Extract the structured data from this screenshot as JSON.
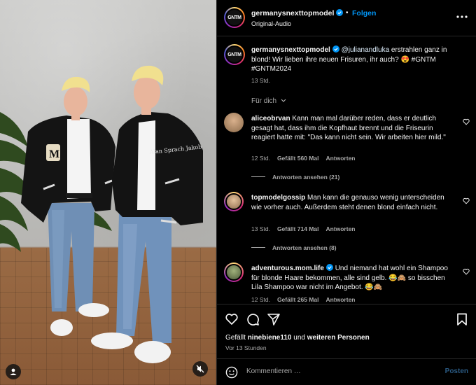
{
  "post": {
    "username": "germanysnexttopmodel",
    "follow_label": "Folgen",
    "separator": "•",
    "audio": "Original-Audio",
    "avatar_text": "GNTM",
    "caption_mention": "@julianandluka",
    "caption_text": " erstrahlen ganz in blond! Wir lieben ihre neuen Frisuren, ihr auch? 😍 #GNTM #GNTM2024",
    "caption_time": "13 Std."
  },
  "filter_label": "Für dich",
  "comments": [
    {
      "username": "aliceobrvan",
      "text": "Kann man mal darüber reden, dass er deutlich gesagt hat, dass ihm die Kopfhaut brennt und die Friseurin reagiert hatte mit: \"Das kann nicht sein. Wir arbeiten hier mild.\"",
      "time": "12 Std.",
      "likes": "Gefällt 560 Mal",
      "reply": "Antworten",
      "view_replies": "Antworten ansehen (21)"
    },
    {
      "username": "topmodelgossip",
      "text": "Man kann die genauso wenig unterscheiden wie vorher auch. Außerdem steht denen blond einfach nicht.",
      "time": "13 Std.",
      "likes": "Gefällt 714 Mal",
      "reply": "Antworten",
      "view_replies": "Antworten ansehen (8)"
    },
    {
      "username": "adventurous.mom.life",
      "text": "Und niemand hat wohl ein Shampoo für blonde Haare bekommen, alle sind gelb. 😂🙈 so bisschen Lila Shampoo war nicht im Angebot. 😂🙈",
      "time": "12 Std.",
      "likes": "Gefällt 265 Mal",
      "reply": "Antworten"
    }
  ],
  "footer": {
    "likes_prefix": "Gefällt ",
    "likes_user": "ninebiene110",
    "likes_mid": " und ",
    "likes_rest": "weiteren Personen",
    "time": "Vor 13 Stunden",
    "comment_placeholder": "Kommentieren …",
    "post_label": "Posten"
  },
  "media": {
    "jacket_patch_left": "M",
    "jacket_script_right": "Alan Sprach Jakob"
  },
  "colors": {
    "accent_blue": "#0095f6",
    "muted_text": "#a8a8a8",
    "background": "#000000",
    "divider": "#262626"
  },
  "icons": [
    "more-icon",
    "verified-icon",
    "heart-icon",
    "comment-icon",
    "share-icon",
    "bookmark-icon",
    "emoji-icon",
    "mute-icon",
    "user-tag-icon",
    "chevron-down-icon"
  ]
}
